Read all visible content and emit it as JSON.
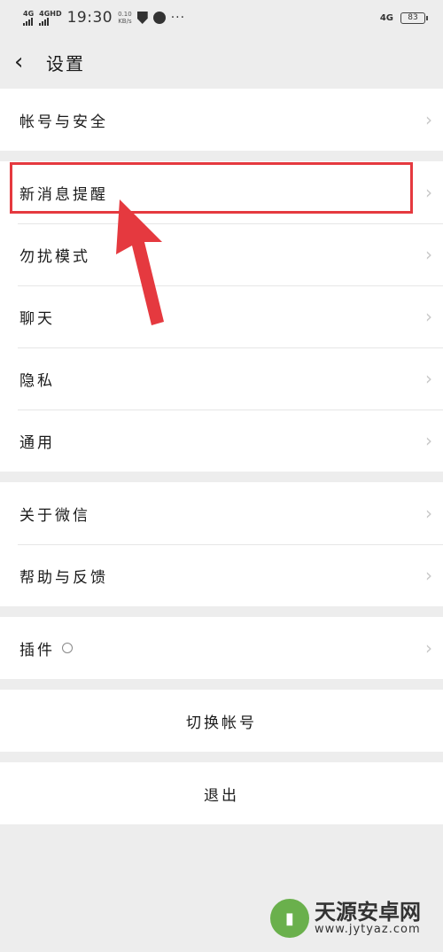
{
  "status_bar": {
    "sim1": "4G",
    "sim2": "4GHD",
    "time": "19:30",
    "speed_value": "0.10",
    "speed_unit": "KB/s",
    "right_network": "4G",
    "battery": "83"
  },
  "header": {
    "back_icon": "chevron-left-icon",
    "title": "设置"
  },
  "groups": {
    "g1": [
      "帐号与安全"
    ],
    "g2": [
      "新消息提醒",
      "勿扰模式",
      "聊天",
      "隐私",
      "通用"
    ],
    "g3": [
      "关于微信",
      "帮助与反馈"
    ],
    "g4": [
      "插件"
    ]
  },
  "actions": {
    "switch_account": "切换帐号",
    "logout": "退出"
  },
  "annotation": {
    "highlight_color": "#e5393f",
    "highlighted_item": "新消息提醒"
  },
  "watermark": {
    "name": "天源安卓网",
    "url": "www.jytyaz.com"
  }
}
